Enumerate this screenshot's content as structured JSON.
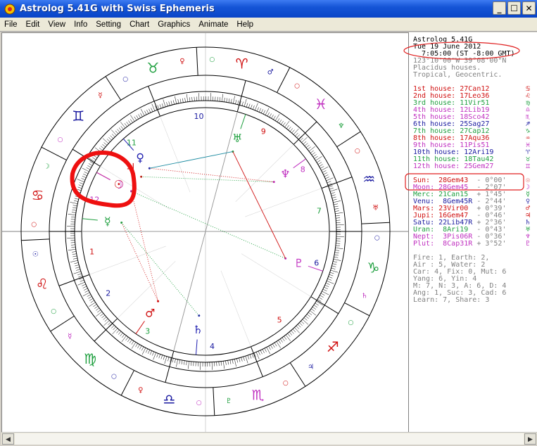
{
  "window": {
    "title": "Astrolog 5.41G with Swiss Ephemeris",
    "minimize_glyph": "_",
    "maximize_glyph": "☐",
    "close_glyph": "✕"
  },
  "menu": [
    "File",
    "Edit",
    "View",
    "Info",
    "Setting",
    "Chart",
    "Graphics",
    "Animate",
    "Help"
  ],
  "chart": {
    "house_numbers": [
      "1",
      "2",
      "3",
      "4",
      "5",
      "6",
      "7",
      "8",
      "9",
      "10",
      "11",
      "12"
    ],
    "sign_glyphs": [
      "♋",
      "♌",
      "♍",
      "♎",
      "♏",
      "♐",
      "♑",
      "♒",
      "♓",
      "♈",
      "♉",
      "♊"
    ],
    "ruler_glyphs": [
      "☽",
      "☉",
      "☿",
      "♀",
      "♇",
      "♃",
      "♄",
      "♅",
      "♆",
      "♂",
      "♀",
      "☿"
    ],
    "planets": [
      {
        "name": "Sun",
        "glyph": "☉",
        "color": "#d01010"
      },
      {
        "name": "Moon",
        "glyph": "☽",
        "color": "#c030c0"
      },
      {
        "name": "Mercury",
        "glyph": "☿",
        "color": "#20a040"
      },
      {
        "name": "Venus",
        "glyph": "♀",
        "color": "#2020b0"
      },
      {
        "name": "Mars",
        "glyph": "♂",
        "color": "#d01010"
      },
      {
        "name": "Jupiter",
        "glyph": "♃",
        "color": "#d01010"
      },
      {
        "name": "Saturn",
        "glyph": "♄",
        "color": "#2020b0"
      },
      {
        "name": "Uranus",
        "glyph": "♅",
        "color": "#20a040"
      },
      {
        "name": "Neptune",
        "glyph": "♆",
        "color": "#c030c0"
      },
      {
        "name": "Pluto",
        "glyph": "♇",
        "color": "#c030c0"
      }
    ]
  },
  "info": {
    "program": "Astrolog 5.41G",
    "date": "Tue 19 June 2012",
    "time": "  7:05:00 (ST -8:00 GMT)",
    "location": "123°10'00\"W 39°08'00\"N",
    "house_system": "Placidus houses.",
    "zodiac": "Tropical, Geocentric."
  },
  "houses": [
    {
      "label": "1st house: ",
      "value": "27Can12",
      "glyph": "♋",
      "color": "#d01010"
    },
    {
      "label": "2nd house: ",
      "value": "17Leo36",
      "glyph": "♌",
      "color": "#d01010"
    },
    {
      "label": "3rd house: ",
      "value": "11Vir51",
      "glyph": "♍",
      "color": "#20a040"
    },
    {
      "label": "4th house: ",
      "value": "12Lib19",
      "glyph": "♎",
      "color": "#c030c0"
    },
    {
      "label": "5th house: ",
      "value": "18Sco42",
      "glyph": "♏",
      "color": "#c030c0"
    },
    {
      "label": "6th house: ",
      "value": "25Sag27",
      "glyph": "♐",
      "color": "#1a1aa0"
    },
    {
      "label": "7th house: ",
      "value": "27Cap12",
      "glyph": "♑",
      "color": "#20a040"
    },
    {
      "label": "8th house: ",
      "value": "17Aqu36",
      "glyph": "♒",
      "color": "#d01010"
    },
    {
      "label": "9th house: ",
      "value": "11Pis51",
      "glyph": "♓",
      "color": "#c030c0"
    },
    {
      "label": "10th house: ",
      "value": "12Ari19",
      "glyph": "♈",
      "color": "#1a1aa0"
    },
    {
      "label": "11th house: ",
      "value": "18Tau42",
      "glyph": "♉",
      "color": "#20a040"
    },
    {
      "label": "12th house: ",
      "value": "25Gem27",
      "glyph": "♊",
      "color": "#c030c0"
    }
  ],
  "positions": [
    {
      "label": "Sun:  ",
      "value": "28Gem43 ",
      "aspect": "- 0°00'",
      "glyph": "☉",
      "color": "#d01010"
    },
    {
      "label": "Moon: ",
      "value": "28Gem45 ",
      "aspect": "- 2°07'",
      "glyph": "☽",
      "color": "#c030c0"
    },
    {
      "label": "Merc: ",
      "value": "21Can15 ",
      "aspect": "+ 1°45'",
      "glyph": "☿",
      "color": "#20a040"
    },
    {
      "label": "Venu: ",
      "value": " 8Gem45R",
      "aspect": "- 2°44'",
      "glyph": "♀",
      "color": "#1a1aa0"
    },
    {
      "label": "Mars: ",
      "value": "23Vir00 ",
      "aspect": "+ 0°39'",
      "glyph": "♂",
      "color": "#d01010"
    },
    {
      "label": "Jupi: ",
      "value": "16Gem47 ",
      "aspect": "- 0°46'",
      "glyph": "♃",
      "color": "#d01010"
    },
    {
      "label": "Satu: ",
      "value": "22Lib47R",
      "aspect": "+ 2°36'",
      "glyph": "♄",
      "color": "#1a1aa0"
    },
    {
      "label": "Uran: ",
      "value": " 8Ari19 ",
      "aspect": "- 0°43'",
      "glyph": "♅",
      "color": "#20a040"
    },
    {
      "label": "Nept: ",
      "value": " 3Pis06R",
      "aspect": "- 0°36'",
      "glyph": "♆",
      "color": "#c030c0"
    },
    {
      "label": "Plut: ",
      "value": " 8Cap31R",
      "aspect": "+ 3°52'",
      "glyph": "♇",
      "color": "#c030c0"
    }
  ],
  "summary": [
    "Fire: 1, Earth: 2,",
    "Air : 5, Water: 2",
    "Car: 4, Fix: 0, Mut: 6",
    "Yang: 6, Yin: 4",
    "M: 7, N: 3, A: 6, D: 4",
    "Ang: 1, Suc: 3, Cad: 6",
    "Learn: 7, Share: 3"
  ],
  "scrollbar": {
    "left_arrow": "◀",
    "right_arrow": "▶"
  }
}
